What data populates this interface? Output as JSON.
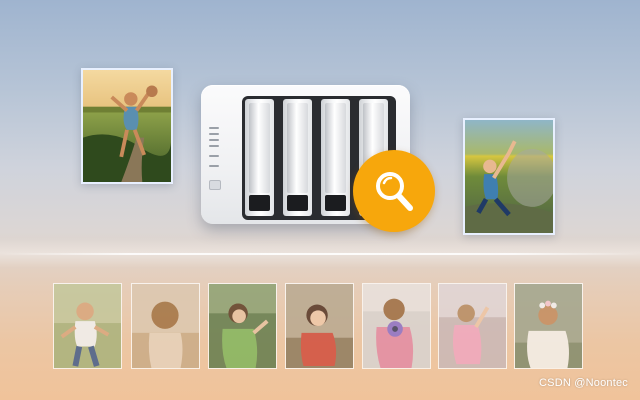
{
  "scene": {
    "icon": "nas-photo-search-illustration",
    "accent_color": "#f7a70c"
  },
  "featured_photos": [
    {
      "icon": "photo-child-playing-in-field"
    },
    {
      "icon": "photo-child-sitting-on-grass"
    }
  ],
  "device": {
    "icon": "nas-storage-device-icon",
    "bay_count": 4
  },
  "search": {
    "icon": "magnifier-icon",
    "color": "#f7a70c"
  },
  "thumbnails": [
    {
      "icon": "photo-boy-running"
    },
    {
      "icon": "photo-girl-back-view"
    },
    {
      "icon": "photo-girl-green-coat"
    },
    {
      "icon": "photo-girl-red-shirt"
    },
    {
      "icon": "photo-girl-with-camera"
    },
    {
      "icon": "photo-girl-pink-dress"
    },
    {
      "icon": "photo-girl-flower-crown"
    }
  ],
  "watermark": {
    "text": "CSDN @Noontec"
  }
}
